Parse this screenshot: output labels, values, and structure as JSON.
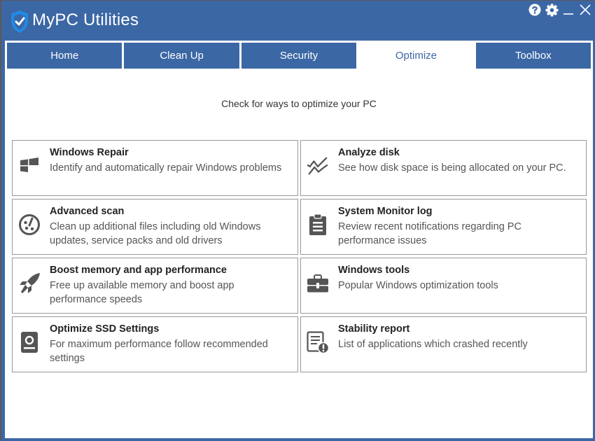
{
  "app": {
    "title": "MyPC Utilities",
    "logo_icon": "shield-check-icon",
    "accent_color": "#3c67a5"
  },
  "window_controls": {
    "help_icon": "help-icon",
    "settings_icon": "gear-icon",
    "minimize_icon": "minimize-icon",
    "close_icon": "close-icon"
  },
  "tabs": [
    {
      "label": "Home",
      "active": false
    },
    {
      "label": "Clean Up",
      "active": false
    },
    {
      "label": "Security",
      "active": false
    },
    {
      "label": "Optimize",
      "active": true
    },
    {
      "label": "Toolbox",
      "active": false
    }
  ],
  "main": {
    "subtitle": "Check for ways to optimize your PC",
    "cards": [
      {
        "title": "Windows Repair",
        "desc": "Identify and automatically repair Windows problems",
        "icon": "windows-logo-icon"
      },
      {
        "title": "Analyze disk",
        "desc": "See how disk space is being allocated on your PC.",
        "icon": "line-chart-icon"
      },
      {
        "title": "Advanced scan",
        "desc": "Clean up additional files including old Windows updates, service packs and old drivers",
        "icon": "gauge-icon"
      },
      {
        "title": "System Monitor log",
        "desc": "Review recent notifications regarding PC performance issues",
        "icon": "clipboard-icon"
      },
      {
        "title": "Boost memory and app performance",
        "desc": "Free up available memory and boost app performance speeds",
        "icon": "rocket-icon"
      },
      {
        "title": "Windows tools",
        "desc": "Popular Windows optimization tools",
        "icon": "toolbox-icon"
      },
      {
        "title": "Optimize SSD Settings",
        "desc": "For maximum performance follow recommended settings",
        "icon": "hard-drive-icon"
      },
      {
        "title": "Stability report",
        "desc": "List of applications which crashed recently",
        "icon": "report-warning-icon"
      }
    ]
  }
}
